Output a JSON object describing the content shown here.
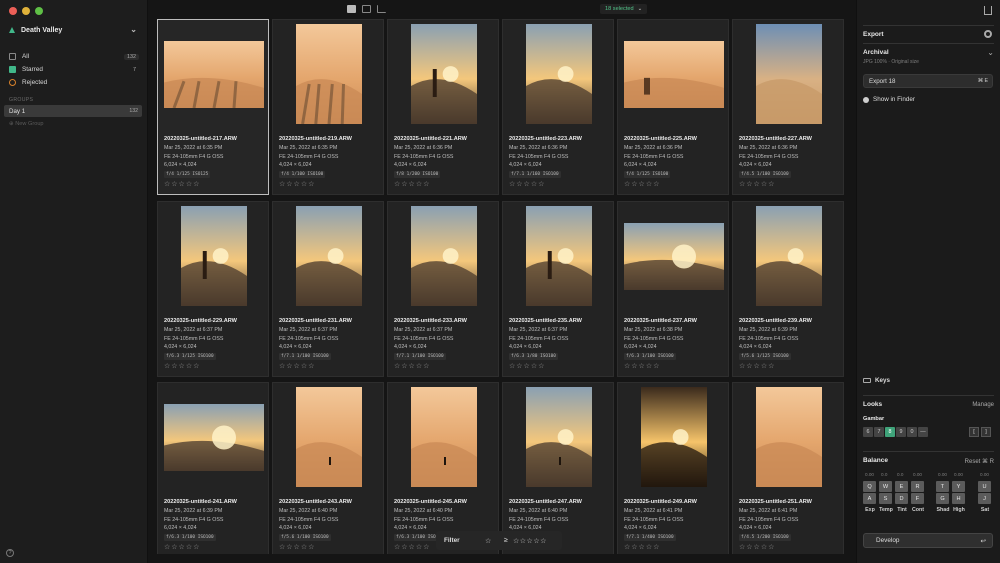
{
  "sidebar": {
    "library": "Death Valley",
    "items": [
      {
        "label": "All",
        "count": "132",
        "color": "#8a8a8a"
      },
      {
        "label": "Starred",
        "count": "7",
        "color": "#41b88a"
      },
      {
        "label": "Rejected",
        "count": "",
        "color": "#d9822b"
      }
    ],
    "groups_heading": "GROUPS",
    "group": {
      "label": "Day 1",
      "count": "132"
    },
    "new_group": "New Group"
  },
  "toolbar": {
    "selected": "18 selected",
    "accent": "#52c48a"
  },
  "photos": [
    {
      "name": "20220325-untitled-217.ARW",
      "date": "Mar 25, 2022 at 6:35 PM",
      "lens": "FE 24-105mm F4 G OSS",
      "size": "6,024 × 4,024",
      "exif": "f/4 1/125 ISO125",
      "selected": true
    },
    {
      "name": "20220325-untitled-219.ARW",
      "date": "Mar 25, 2022 at 6:35 PM",
      "lens": "FE 24-105mm F4 G OSS",
      "size": "4,024 × 6,024",
      "exif": "f/4 1/100 ISO100"
    },
    {
      "name": "20220325-untitled-221.ARW",
      "date": "Mar 25, 2022 at 6:36 PM",
      "lens": "FE 24-105mm F4 G OSS",
      "size": "4,024 × 6,024",
      "exif": "f/8 1/200 ISO100"
    },
    {
      "name": "20220325-untitled-223.ARW",
      "date": "Mar 25, 2022 at 6:36 PM",
      "lens": "FE 24-105mm F4 G OSS",
      "size": "4,024 × 6,024",
      "exif": "f/7.1 1/160 ISO100"
    },
    {
      "name": "20220325-untitled-225.ARW",
      "date": "Mar 25, 2022 at 6:36 PM",
      "lens": "FE 24-105mm F4 G OSS",
      "size": "6,024 × 4,024",
      "exif": "f/4 1/125 ISO100"
    },
    {
      "name": "20220325-untitled-227.ARW",
      "date": "Mar 25, 2022 at 6:36 PM",
      "lens": "FE 24-105mm F4 G OSS",
      "size": "4,024 × 6,024",
      "exif": "f/4.5 1/100 ISO100"
    },
    {
      "name": "20220325-untitled-229.ARW",
      "date": "Mar 25, 2022 at 6:37 PM",
      "lens": "FE 24-105mm F4 G OSS",
      "size": "4,024 × 6,024",
      "exif": "f/6.3 1/125 ISO100"
    },
    {
      "name": "20220325-untitled-231.ARW",
      "date": "Mar 25, 2022 at 6:37 PM",
      "lens": "FE 24-105mm F4 G OSS",
      "size": "4,024 × 6,024",
      "exif": "f/7.1 1/100 ISO100"
    },
    {
      "name": "20220325-untitled-233.ARW",
      "date": "Mar 25, 2022 at 6:37 PM",
      "lens": "FE 24-105mm F4 G OSS",
      "size": "4,024 × 6,024",
      "exif": "f/7.1 1/100 ISO100"
    },
    {
      "name": "20220325-untitled-235.ARW",
      "date": "Mar 25, 2022 at 6:37 PM",
      "lens": "FE 24-105mm F4 G OSS",
      "size": "4,024 × 6,024",
      "exif": "f/6.3 1/80 ISO100"
    },
    {
      "name": "20220325-untitled-237.ARW",
      "date": "Mar 25, 2022 at 6:38 PM",
      "lens": "FE 24-105mm F4 G OSS",
      "size": "6,024 × 4,024",
      "exif": "f/6.3 1/100 ISO100"
    },
    {
      "name": "20220325-untitled-239.ARW",
      "date": "Mar 25, 2022 at 6:39 PM",
      "lens": "FE 24-105mm F4 G OSS",
      "size": "4,024 × 6,024",
      "exif": "f/5.6 1/125 ISO100"
    },
    {
      "name": "20220325-untitled-241.ARW",
      "date": "Mar 25, 2022 at 6:39 PM",
      "lens": "FE 24-105mm F4 G OSS",
      "size": "6,024 × 4,024",
      "exif": "f/6.3 1/100 ISO100"
    },
    {
      "name": "20220325-untitled-243.ARW",
      "date": "Mar 25, 2022 at 6:40 PM",
      "lens": "FE 24-105mm F4 G OSS",
      "size": "4,024 × 6,024",
      "exif": "f/5.6 1/100 ISO100"
    },
    {
      "name": "20220325-untitled-245.ARW",
      "date": "Mar 25, 2022 at 6:40 PM",
      "lens": "FE 24-105mm F4 G OSS",
      "size": "4,024 × 6,024",
      "exif": "f/6.3 1/100 ISO100"
    },
    {
      "name": "20220325-untitled-247.ARW",
      "date": "Mar 25, 2022 at 6:40 PM",
      "lens": "FE 24-105mm F4 G OSS",
      "size": "4,024 × 6,024",
      "exif": "f/6.3 1/100 ISO100"
    },
    {
      "name": "20220325-untitled-249.ARW",
      "date": "Mar 25, 2022 at 6:41 PM",
      "lens": "FE 24-105mm F4 G OSS",
      "size": "4,024 × 6,024",
      "exif": "f/7.1 1/400 ISO100"
    },
    {
      "name": "20220325-untitled-251.ARW",
      "date": "Mar 25, 2022 at 6:41 PM",
      "lens": "FE 24-105mm F4 G OSS",
      "size": "4,024 × 6,024",
      "exif": "f/4.5 1/200 ISO100"
    }
  ],
  "filter": {
    "label": "Filter",
    "ge": "≥"
  },
  "panel": {
    "export_title": "Export",
    "preset_name": "Archival",
    "preset_desc": "JPG 100% · Original size",
    "export_button": "Export 18",
    "export_shortcut": "⌘ E",
    "show_in_finder": "Show in Finder",
    "keys_label": "Keys",
    "looks_label": "Looks",
    "manage_label": "Manage",
    "gambar_label": "Gambar",
    "gambar_keys": [
      "6",
      "7",
      "8",
      "9",
      "0",
      "—"
    ],
    "brackets": [
      "[",
      "]"
    ],
    "balance_label": "Balance",
    "reset_label": "Reset ⌘ R",
    "balance_values": [
      "0.00",
      "0.0",
      "0.0",
      "0.00",
      "0.00",
      "0.00",
      "0.00"
    ],
    "balance_upper": [
      "Q",
      "W",
      "E",
      "R",
      "T",
      "Y",
      "U"
    ],
    "balance_lower": [
      "A",
      "S",
      "D",
      "F",
      "G",
      "H",
      "J"
    ],
    "balance_labels": [
      "Exp",
      "Temp",
      "Tint",
      "Cont",
      "Shad",
      "High",
      "Sat"
    ],
    "develop_label": "Develop",
    "develop_shortcut": "↩"
  }
}
